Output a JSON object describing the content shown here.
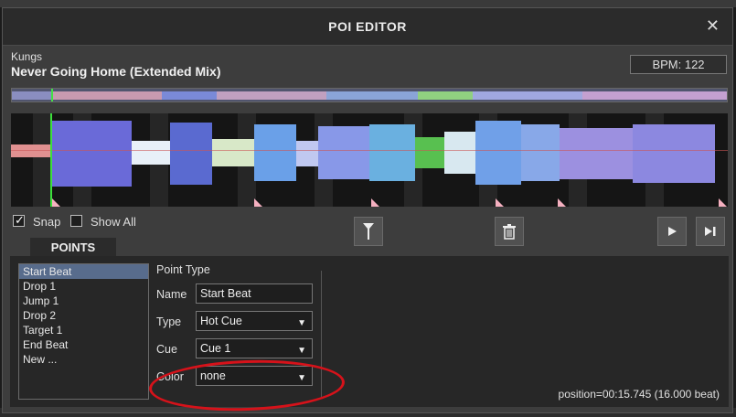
{
  "dialog": {
    "title": "POI EDITOR",
    "close_icon": "close-icon"
  },
  "track": {
    "artist": "Kungs",
    "title": "Never Going Home (Extended Mix)",
    "bpm_label": "BPM: 122"
  },
  "controls": {
    "snap_label": "Snap",
    "snap_checked": true,
    "show_all_label": "Show All",
    "show_all_checked": false,
    "icons": [
      "marker-icon",
      "trash-icon",
      "play-icon",
      "next-icon"
    ]
  },
  "tabs": {
    "points": "POINTS"
  },
  "points": {
    "items": [
      "Start Beat",
      "Drop 1",
      "Jump 1",
      "Drop 2",
      "Target 1",
      "End Beat",
      "New ..."
    ],
    "selected": "Start Beat"
  },
  "form": {
    "section_title": "Point Type",
    "name_label": "Name",
    "name_value": "Start Beat",
    "type_label": "Type",
    "type_value": "Hot Cue",
    "cue_label": "Cue",
    "cue_value": "Cue 1",
    "color_label": "Color",
    "color_value": "none"
  },
  "status": {
    "position": "position=00:15.745 (16.000 beat)"
  },
  "colors": {
    "accent_select": "#586c8c",
    "annotation": "#d6121a",
    "cursor": "#3ce03c"
  }
}
